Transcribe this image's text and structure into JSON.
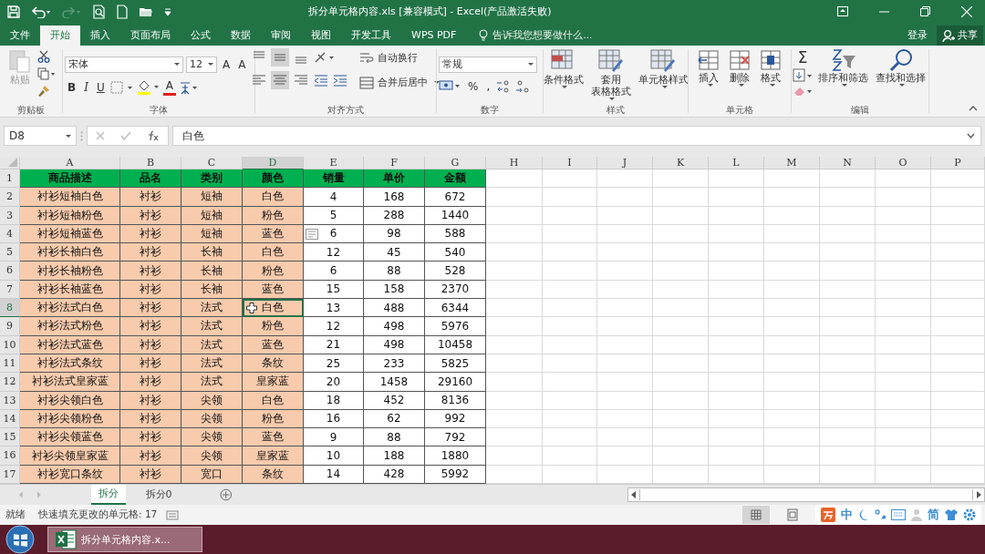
{
  "window": {
    "title": "拆分单元格内容.xls  [兼容模式] - Excel(产品激活失败)"
  },
  "ribbon_tabs": [
    {
      "label": "文件",
      "selected": false
    },
    {
      "label": "开始",
      "selected": true
    },
    {
      "label": "插入",
      "selected": false
    },
    {
      "label": "页面布局",
      "selected": false
    },
    {
      "label": "公式",
      "selected": false
    },
    {
      "label": "数据",
      "selected": false
    },
    {
      "label": "审阅",
      "selected": false
    },
    {
      "label": "视图",
      "selected": false
    },
    {
      "label": "开发工具",
      "selected": false
    },
    {
      "label": "WPS PDF",
      "selected": false
    }
  ],
  "tell_me": {
    "placeholder": "告诉我您想要做什么..."
  },
  "account": {
    "login": "登录",
    "share": "共享"
  },
  "ribbon": {
    "clipboard": {
      "name": "剪贴板",
      "paste": "粘贴"
    },
    "font": {
      "name": "字体",
      "font_name": "宋体",
      "font_size": "12",
      "grow": "A",
      "shrink": "A",
      "bold": "B",
      "italic": "I",
      "underline": "U",
      "color_letter": "A"
    },
    "alignment": {
      "name": "对齐方式",
      "wrap": "自动换行",
      "merge": "合并后居中"
    },
    "number": {
      "name": "数字",
      "format": "常规",
      "percent": "%",
      "comma": ","
    },
    "styles": {
      "name": "样式",
      "buttons": [
        {
          "lines": [
            "条件格式"
          ]
        },
        {
          "lines": [
            "套用",
            "表格格式"
          ]
        },
        {
          "lines": [
            "单元格样式"
          ]
        }
      ]
    },
    "cells": {
      "name": "单元格",
      "buttons": [
        "插入",
        "删除",
        "格式"
      ]
    },
    "editing": {
      "name": "编辑",
      "sum": "Σ",
      "buttons": [
        "排序和筛选",
        "查找和选择"
      ]
    }
  },
  "name_box": "D8",
  "formula": "白色",
  "columns": [
    {
      "label": "A",
      "selected": false
    },
    {
      "label": "B",
      "selected": false
    },
    {
      "label": "C",
      "selected": false
    },
    {
      "label": "D",
      "selected": true
    },
    {
      "label": "E",
      "selected": false
    },
    {
      "label": "F",
      "selected": false
    },
    {
      "label": "G",
      "selected": false
    },
    {
      "label": "H",
      "selected": false
    },
    {
      "label": "I",
      "selected": false
    },
    {
      "label": "J",
      "selected": false
    },
    {
      "label": "K",
      "selected": false
    },
    {
      "label": "L",
      "selected": false
    },
    {
      "label": "M",
      "selected": false
    },
    {
      "label": "N",
      "selected": false
    },
    {
      "label": "O",
      "selected": false
    },
    {
      "label": "P",
      "selected": false
    }
  ],
  "rows": [
    {
      "num": "1",
      "selected": false,
      "kind": "header",
      "cells": [
        "商品描述",
        "品名",
        "类别",
        "颜色",
        "销量",
        "单价",
        "金额"
      ]
    },
    {
      "num": "2",
      "selected": false,
      "cells": [
        "衬衫短袖白色",
        "衬衫",
        "短袖",
        "白色",
        "4",
        "168",
        "672"
      ]
    },
    {
      "num": "3",
      "selected": false,
      "cells": [
        "衬衫短袖粉色",
        "衬衫",
        "短袖",
        "粉色",
        "5",
        "288",
        "1440"
      ]
    },
    {
      "num": "4",
      "selected": false,
      "flash_fill_icon": true,
      "cells": [
        "衬衫短袖蓝色",
        "衬衫",
        "短袖",
        "蓝色",
        "6",
        "98",
        "588"
      ]
    },
    {
      "num": "5",
      "selected": false,
      "cells": [
        "衬衫长袖白色",
        "衬衫",
        "长袖",
        "白色",
        "12",
        "45",
        "540"
      ]
    },
    {
      "num": "6",
      "selected": false,
      "cells": [
        "衬衫长袖粉色",
        "衬衫",
        "长袖",
        "粉色",
        "6",
        "88",
        "528"
      ]
    },
    {
      "num": "7",
      "selected": false,
      "cells": [
        "衬衫长袖蓝色",
        "衬衫",
        "长袖",
        "蓝色",
        "15",
        "158",
        "2370"
      ]
    },
    {
      "num": "8",
      "selected": true,
      "cells": [
        "衬衫法式白色",
        "衬衫",
        "法式",
        "白色",
        "13",
        "488",
        "6344"
      ]
    },
    {
      "num": "9",
      "selected": false,
      "cells": [
        "衬衫法式粉色",
        "衬衫",
        "法式",
        "粉色",
        "12",
        "498",
        "5976"
      ]
    },
    {
      "num": "10",
      "selected": false,
      "cells": [
        "衬衫法式蓝色",
        "衬衫",
        "法式",
        "蓝色",
        "21",
        "498",
        "10458"
      ]
    },
    {
      "num": "11",
      "selected": false,
      "cells": [
        "衬衫法式条纹",
        "衬衫",
        "法式",
        "条纹",
        "25",
        "233",
        "5825"
      ]
    },
    {
      "num": "12",
      "selected": false,
      "cells": [
        "衬衫法式皇家蓝",
        "衬衫",
        "法式",
        "皇家蓝",
        "20",
        "1458",
        "29160"
      ]
    },
    {
      "num": "13",
      "selected": false,
      "cells": [
        "衬衫尖领白色",
        "衬衫",
        "尖领",
        "白色",
        "18",
        "452",
        "8136"
      ]
    },
    {
      "num": "14",
      "selected": false,
      "cells": [
        "衬衫尖领粉色",
        "衬衫",
        "尖领",
        "粉色",
        "16",
        "62",
        "992"
      ]
    },
    {
      "num": "15",
      "selected": false,
      "cells": [
        "衬衫尖领蓝色",
        "衬衫",
        "尖领",
        "蓝色",
        "9",
        "88",
        "792"
      ]
    },
    {
      "num": "16",
      "selected": false,
      "cells": [
        "衬衫尖领皇家蓝",
        "衬衫",
        "尖领",
        "皇家蓝",
        "10",
        "188",
        "1880"
      ]
    },
    {
      "num": "17",
      "selected": false,
      "cells": [
        "衬衫宽口条纹",
        "衬衫",
        "宽口",
        "条纹",
        "14",
        "428",
        "5992"
      ]
    }
  ],
  "sheet_tabs": [
    {
      "label": "拆分",
      "selected": true
    },
    {
      "label": "拆分0",
      "selected": false
    }
  ],
  "status_bar": {
    "state": "就绪",
    "message": "快速填充更改的单元格: 17"
  },
  "ime_bar": {
    "mode": "中",
    "script": "简"
  },
  "taskbar": {
    "task": "拆分单元格内容.x..."
  }
}
